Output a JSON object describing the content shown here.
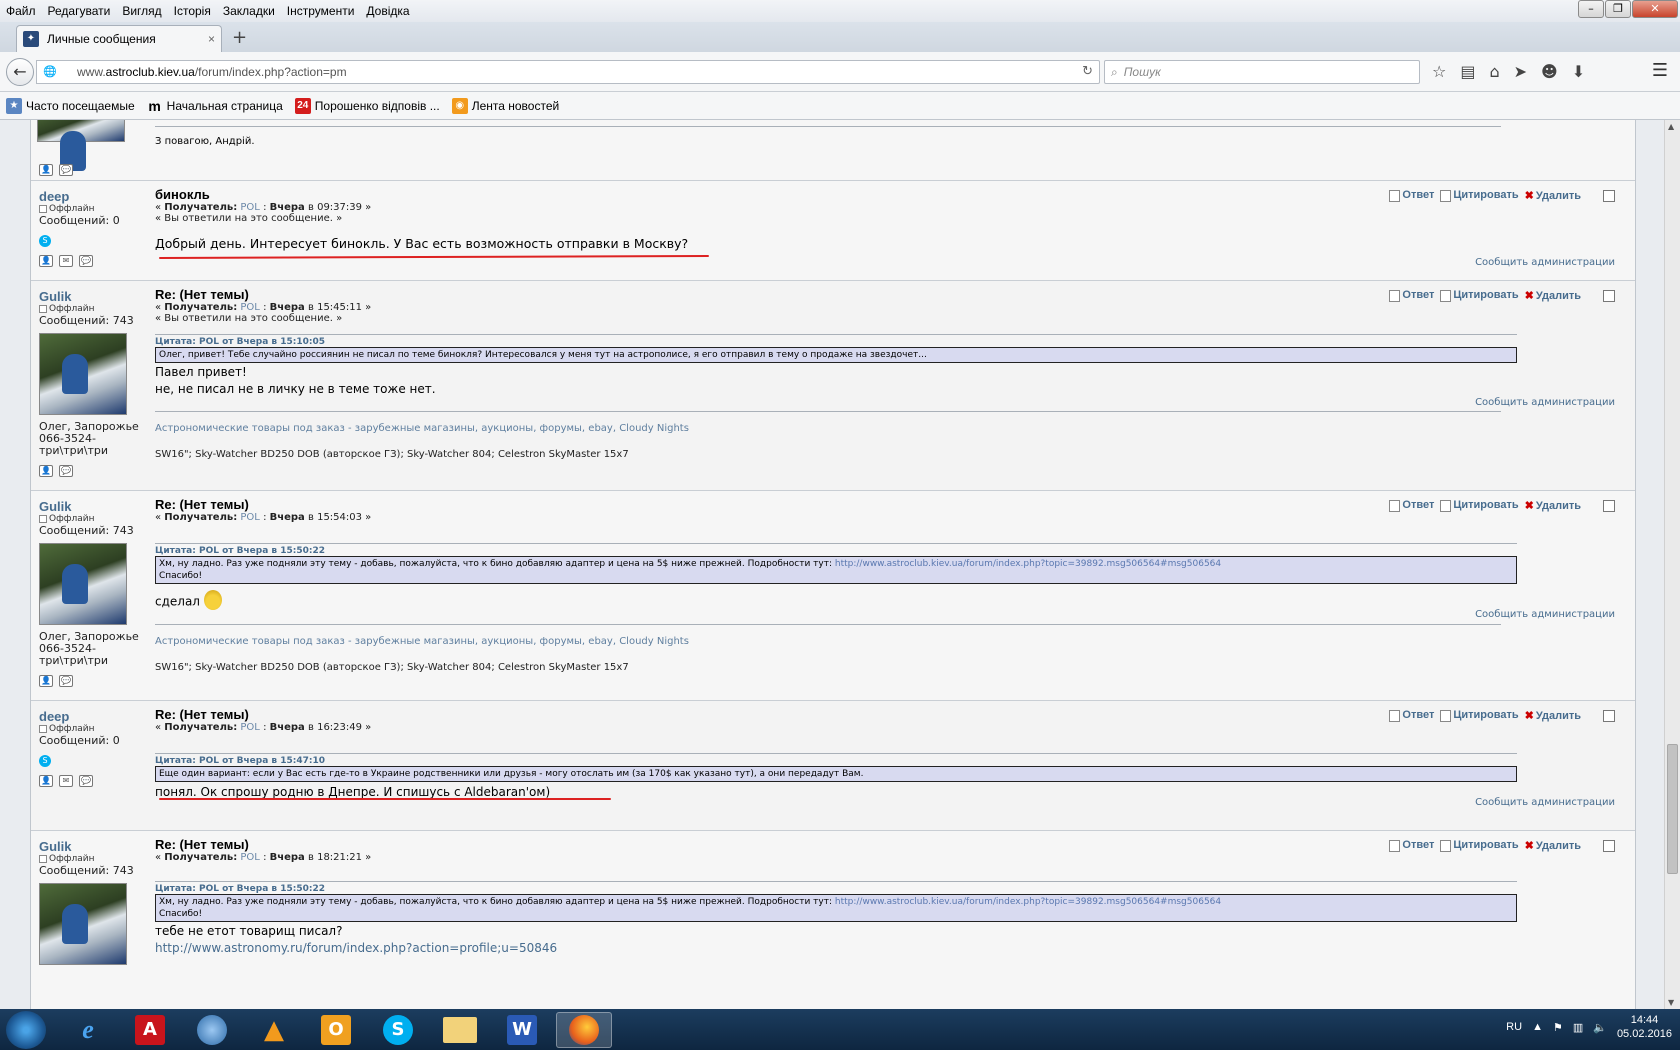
{
  "menu": [
    "Файл",
    "Редагувати",
    "Вигляд",
    "Історія",
    "Закладки",
    "Інструменти",
    "Довідка"
  ],
  "tab": {
    "title": "Личные сообщения",
    "close": "×",
    "new": "+"
  },
  "nav": {
    "url_prefix": "www.",
    "url_host": "astroclub.kiev.ua",
    "url_path": "/forum/index.php?action=pm",
    "search_placeholder": "Пошук"
  },
  "bookmarks": [
    {
      "label": "Часто посещаемые",
      "icon": "frequent-icon"
    },
    {
      "label": "Начальная страница",
      "icon": "m-logo-icon"
    },
    {
      "label": "Порошенко відповів ...",
      "icon": "24-news-icon"
    },
    {
      "label": "Лента новостей",
      "icon": "rss-icon"
    }
  ],
  "top_fragment": {
    "text": "З повагою, Андрій."
  },
  "actions": {
    "reply": "Ответ",
    "quote": "Цитировать",
    "delete": "Удалить",
    "report": "Сообщить администрации"
  },
  "status": {
    "offline": "Оффлайн"
  },
  "signature": {
    "links": "Астрономические товары под заказ - зарубежные магазины, аукционы, форумы, ebay, Cloudy Nights",
    "gear": "SW16\"; Sky-Watcher BD250 DOB (авторское ГЗ); Sky-Watcher 804; Celestron SkyMaster 15x7"
  },
  "posts": [
    {
      "author": "deep",
      "messages": "Сообщений: 0",
      "subject": "бинокль",
      "recipient_label": "Получатель:",
      "recipient": "POL",
      "day": "Вчера",
      "time": "09:37:39",
      "replied": "« Вы ответили на это сообщение. »",
      "text": "Добрый день. Интересует бинокль. У Вас есть возможность отправки в Москву?"
    },
    {
      "author": "Gulik",
      "messages": "Сообщений: 743",
      "location": "Олег, Запорожье 066-3524-три\\три\\три",
      "subject": "Re: (Нет темы)",
      "recipient_label": "Получатель:",
      "recipient": "POL",
      "day": "Вчера",
      "time": "15:45:11",
      "replied": "« Вы ответили на это сообщение. »",
      "quote_header": "Цитата: POL от Вчера в 15:10:05",
      "quote": "Олег, привет! Тебе случайно россиянин не писал по теме бинокля? Интересовался у меня тут на астрополисе, я его отправил в тему о продаже на звездочет...",
      "text1": "Павел привет!",
      "text2": "не, не писал не в личку не в теме тоже нет."
    },
    {
      "author": "Gulik",
      "messages": "Сообщений: 743",
      "location": "Олег, Запорожье 066-3524-три\\три\\три",
      "subject": "Re: (Нет темы)",
      "recipient_label": "Получатель:",
      "recipient": "POL",
      "day": "Вчера",
      "time": "15:54:03",
      "quote_header": "Цитата: POL от Вчера в 15:50:22",
      "quote": "Хм, ну ладно. Раз уже подняли эту тему - добавь, пожалуйста, что к бино добавляю адаптер и цена на 5$ ниже прежней. Подробности тут: ",
      "quote_link": "http://www.astroclub.kiev.ua/forum/index.php?topic=39892.msg506564#msg506564",
      "quote_end": "Спасибо!",
      "text": "сделал"
    },
    {
      "author": "deep",
      "messages": "Сообщений: 0",
      "subject": "Re: (Нет темы)",
      "recipient_label": "Получатель:",
      "recipient": "POL",
      "day": "Вчера",
      "time": "16:23:49",
      "quote_header": "Цитата: POL от Вчера в 15:47:10",
      "quote": "Еще один вариант: если у Вас есть где-то в Украине родственники или друзья - могу отослать им (за 170$ как указано тут), а они передадут Вам.",
      "text": "понял. Ок спрошу родню в Днепре. И спишусь с Aldebaran'ом)"
    },
    {
      "author": "Gulik",
      "messages": "Сообщений: 743",
      "subject": "Re: (Нет темы)",
      "recipient_label": "Получатель:",
      "recipient": "POL",
      "day": "Вчера",
      "time": "18:21:21",
      "quote_header": "Цитата: POL от Вчера в 15:50:22",
      "quote": "Хм, ну ладно. Раз уже подняли эту тему - добавь, пожалуйста, что к бино добавляю адаптер и цена на 5$ ниже прежней. Подробности тут: ",
      "quote_link": "http://www.astroclub.kiev.ua/forum/index.php?topic=39892.msg506564#msg506564",
      "quote_end": "Спасибо!",
      "text1": "тебе не етот товарищ писал?",
      "text_link": "http://www.astronomy.ru/forum/index.php?action=profile;u=50846"
    }
  ],
  "tray": {
    "lang": "RU",
    "time": "14:44",
    "date": "05.02.2016"
  },
  "colors": {
    "accent_link": "#476c8e",
    "annotation_red": "#d22"
  }
}
